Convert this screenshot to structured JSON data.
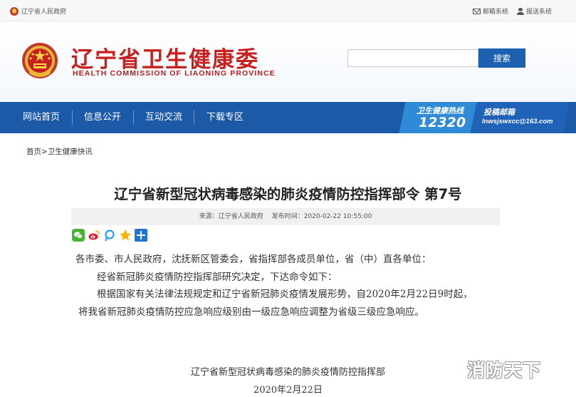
{
  "topbar": {
    "gov_link": "辽宁省人民政府",
    "mail_system": "邮箱系统",
    "submit_system": "报送系统"
  },
  "header": {
    "title_cn": "辽宁省卫生健康委",
    "title_en": "HEALTH COMMISSION OF LIAONING PROVINCE",
    "search_value": "",
    "search_button": "搜索"
  },
  "nav": {
    "items": [
      "网站首页",
      "信息公开",
      "互动交流",
      "下载专区"
    ],
    "hotline_label": "卫生健康热线",
    "hotline_number": "12320",
    "mailbox_label": "投稿邮箱",
    "mailbox_address": "lnwsjswxcc@163.com"
  },
  "breadcrumb": {
    "home": "首页",
    "sep": ">",
    "current": "卫生健康快讯"
  },
  "article": {
    "title": "辽宁省新型冠状病毒感染的肺炎疫情防控指挥部令 第7号",
    "source": "来源：辽宁省人民政府",
    "published": "发布时间：2020-02-22 10:55:00",
    "paragraphs": [
      "各市委、市人民政府，沈抚新区管委会，省指挥部各成员单位，省（中）直各单位：",
      "经省新冠肺炎疫情防控指挥部研究决定，下达命令如下：",
      "根据国家有关法律法规规定和辽宁省新冠肺炎疫情发展形势，自2020年2月22日9时起，",
      "将我省新冠肺炎疫情防控应急响应级别由一级应急响应调整为省级三级应急响应。"
    ],
    "signature_org": "辽宁省新型冠状病毒感染的肺炎疫情防控指挥部",
    "signature_date": "2020年2月22日"
  },
  "share": {
    "icons": [
      "wechat-icon",
      "weibo-icon",
      "qzone-icon",
      "favorite-icon",
      "more-icon"
    ]
  },
  "watermark": "消防天下",
  "colors": {
    "brand_red": "#c8201f",
    "nav_blue": "#1c5aa8",
    "search_blue": "#1d5fb0",
    "hotline_blue": "#2f8ad8"
  }
}
